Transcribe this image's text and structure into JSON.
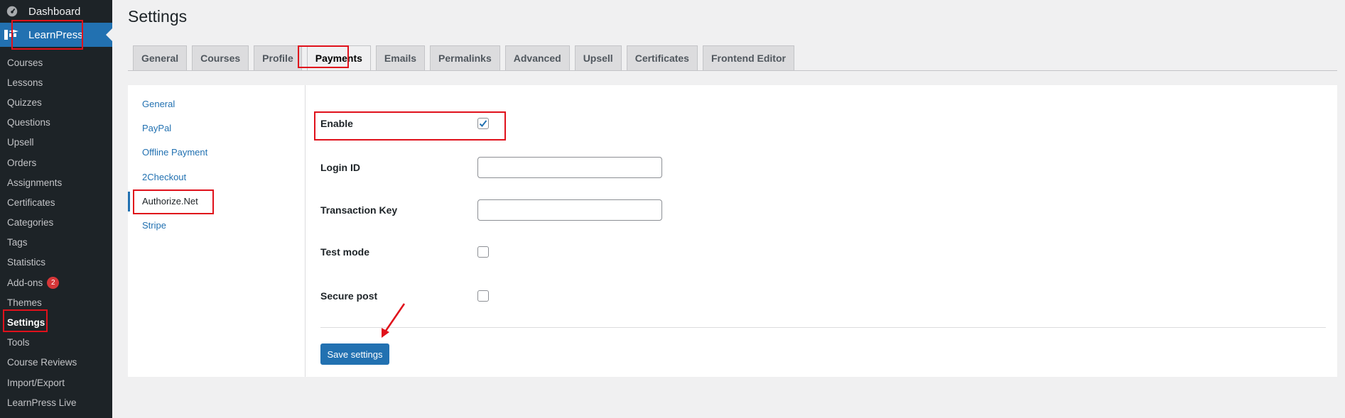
{
  "sidebar": {
    "dashboard_label": "Dashboard",
    "plugin_label": "LearnPress",
    "items": [
      {
        "label": "Courses"
      },
      {
        "label": "Lessons"
      },
      {
        "label": "Quizzes"
      },
      {
        "label": "Questions"
      },
      {
        "label": "Upsell"
      },
      {
        "label": "Orders"
      },
      {
        "label": "Assignments"
      },
      {
        "label": "Certificates"
      },
      {
        "label": "Categories"
      },
      {
        "label": "Tags"
      },
      {
        "label": "Statistics"
      },
      {
        "label": "Add-ons",
        "badge": "2"
      },
      {
        "label": "Themes"
      },
      {
        "label": "Settings",
        "current": true
      },
      {
        "label": "Tools"
      },
      {
        "label": "Course Reviews"
      },
      {
        "label": "Import/Export"
      },
      {
        "label": "LearnPress Live"
      }
    ]
  },
  "page": {
    "title": "Settings"
  },
  "tabs": [
    {
      "label": "General"
    },
    {
      "label": "Courses"
    },
    {
      "label": "Profile"
    },
    {
      "label": "Payments",
      "active": true
    },
    {
      "label": "Emails"
    },
    {
      "label": "Permalinks"
    },
    {
      "label": "Advanced"
    },
    {
      "label": "Upsell"
    },
    {
      "label": "Certificates"
    },
    {
      "label": "Frontend Editor"
    }
  ],
  "subnav": [
    {
      "label": "General"
    },
    {
      "label": "PayPal"
    },
    {
      "label": "Offline Payment"
    },
    {
      "label": "2Checkout"
    },
    {
      "label": "Authorize.Net",
      "active": true
    },
    {
      "label": "Stripe"
    }
  ],
  "form": {
    "enable": {
      "label": "Enable",
      "checked": true
    },
    "login_id": {
      "label": "Login ID",
      "value": ""
    },
    "transaction_key": {
      "label": "Transaction Key",
      "value": ""
    },
    "test_mode": {
      "label": "Test mode",
      "checked": false
    },
    "secure_post": {
      "label": "Secure post",
      "checked": false
    },
    "save_label": "Save settings"
  },
  "colors": {
    "sidebar_bg": "#1d2327",
    "accent": "#2271b1",
    "annotation_red": "#e0111b",
    "badge_red": "#d63638"
  }
}
